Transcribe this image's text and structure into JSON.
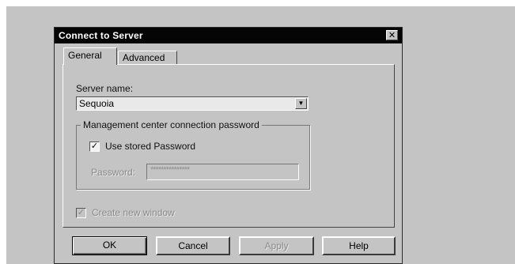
{
  "dialog": {
    "title": "Connect to Server",
    "close_glyph": "✕"
  },
  "tabs": [
    {
      "label": "General",
      "active": true
    },
    {
      "label": "Advanced",
      "active": false
    }
  ],
  "general": {
    "server_name_label": "Server name:",
    "server_name_value": "Sequoia",
    "combo_arrow": "▼",
    "group_title": "Management center connection password",
    "use_stored_label": "Use stored Password",
    "use_stored_checked": true,
    "password_label": "Password:",
    "password_value": "***************",
    "password_enabled": false,
    "create_window_label": "Create new window",
    "create_window_checked": true,
    "create_window_enabled": false,
    "check_glyph": "✓"
  },
  "buttons": {
    "ok": "OK",
    "cancel": "Cancel",
    "apply": "Apply",
    "help": "Help"
  }
}
